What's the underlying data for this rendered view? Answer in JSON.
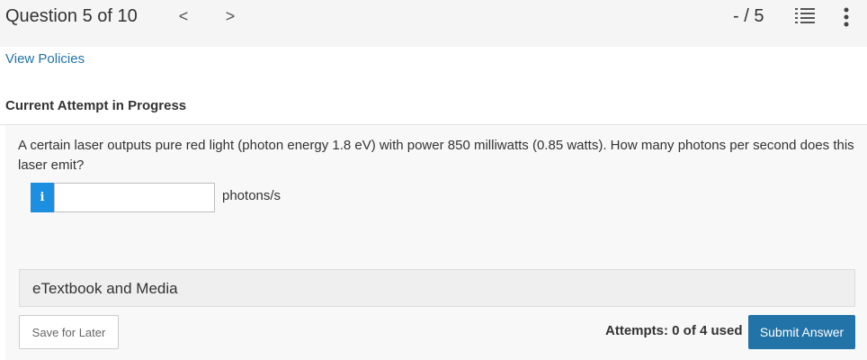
{
  "header": {
    "question_counter": "Question 5 of 10",
    "prev_glyph": "<",
    "next_glyph": ">",
    "score": "- / 5",
    "icons": {
      "list": "list-icon",
      "more": "more-vertical-icon",
      "prev": "chevron-left-icon",
      "next": "chevron-right-icon"
    }
  },
  "links": {
    "view_policies": "View Policies"
  },
  "attempt": {
    "heading": "Current Attempt in Progress"
  },
  "question": {
    "text": "A certain laser outputs pure red light (photon energy 1.8 eV) with power 850 milliwatts (0.85 watts). How many photons per second does this laser emit?",
    "info_badge": "i",
    "answer_value": "",
    "answer_placeholder": "",
    "unit": "photons/s"
  },
  "etextbook": {
    "label": "eTextbook and Media"
  },
  "footer": {
    "save_label": "Save for Later",
    "attempts_text": "Attempts: 0 of 4 used",
    "submit_label": "Submit Answer"
  },
  "colors": {
    "accent": "#2273a8",
    "info_badge": "#1c8fe0",
    "header_bg": "#f5f5f5",
    "panel_bg": "#f8f8f8"
  }
}
